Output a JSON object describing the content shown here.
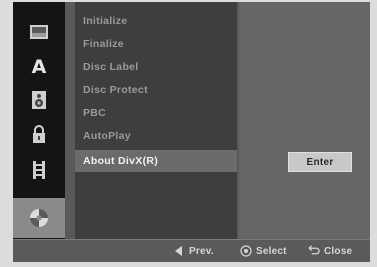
{
  "menu": {
    "items": [
      {
        "label": "Initialize",
        "active": false
      },
      {
        "label": "Finalize",
        "active": false
      },
      {
        "label": "Disc Label",
        "active": false
      },
      {
        "label": "Disc Protect",
        "active": false
      },
      {
        "label": "PBC",
        "active": false
      },
      {
        "label": "AutoPlay",
        "active": false
      },
      {
        "label": "About DivX(R)",
        "active": true
      }
    ]
  },
  "panel": {
    "enter_label": "Enter"
  },
  "rail": {
    "icons": [
      "picture-icon",
      "language-icon",
      "speaker-icon",
      "lock-icon",
      "film-icon",
      "disc-icon"
    ]
  },
  "bottom_bar": {
    "prev_label": "Prev.",
    "select_label": "Select",
    "close_label": "Close"
  }
}
